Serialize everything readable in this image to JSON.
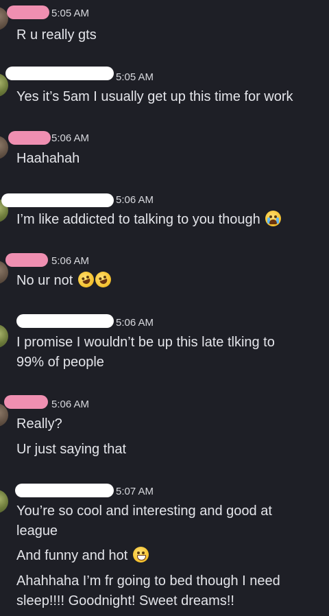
{
  "messages": [
    {
      "sender": "pink",
      "timestamp": "5:05 AM",
      "lines": [
        "R u really gts"
      ]
    },
    {
      "sender": "white",
      "timestamp": "5:05 AM",
      "lines": [
        "Yes it’s 5am I usually get up this time for work"
      ]
    },
    {
      "sender": "pink",
      "timestamp": "5:06 AM",
      "lines": [
        "Haahahah"
      ]
    },
    {
      "sender": "white",
      "timestamp": "5:06 AM",
      "lines": [
        "I’m like addicted to talking to you though"
      ],
      "emoji": "loudly-crying-face"
    },
    {
      "sender": "pink",
      "timestamp": "5:06 AM",
      "lines": [
        "No ur not"
      ],
      "emoji": "rolling-on-floor-laughing x2"
    },
    {
      "sender": "white",
      "timestamp": "5:06 AM",
      "lines": [
        "I promise I wouldn’t be up this late tlking to",
        "99% of people"
      ]
    },
    {
      "sender": "pink",
      "timestamp": "5:06 AM",
      "lines": [
        "Really?",
        "Ur just saying that"
      ]
    },
    {
      "sender": "white",
      "timestamp": "5:07 AM",
      "lines": [
        "You’re so cool and interesting and good at",
        "league",
        "And funny and hot",
        "Ahahhaha I’m fr going to bed though I need",
        "sleep!!!! Goodnight! Sweet dreams!!"
      ],
      "emoji": "grinning-face"
    }
  ],
  "colors": {
    "background": "#1e1f26",
    "pink_redaction": "#ef8fb1",
    "white_redaction": "#ffffff",
    "text": "#e4e5ea"
  }
}
